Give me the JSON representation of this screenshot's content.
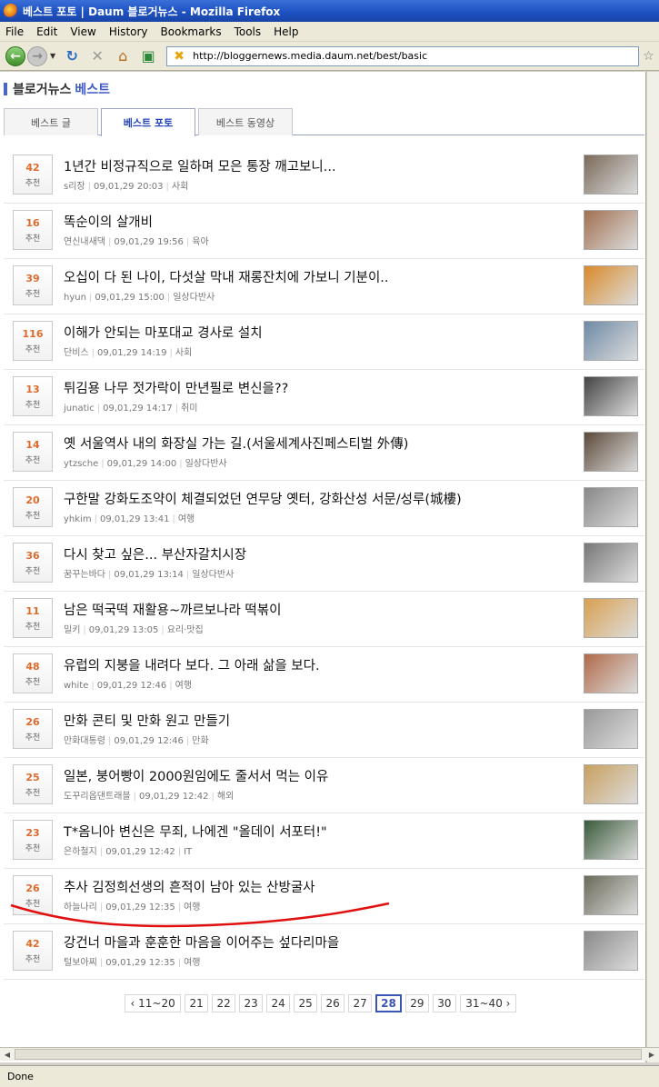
{
  "window": {
    "title": "베스트 포토 | Daum 블로거뉴스 - Mozilla Firefox"
  },
  "menu": [
    "File",
    "Edit",
    "View",
    "History",
    "Bookmarks",
    "Tools",
    "Help"
  ],
  "address": {
    "url": "http://bloggernews.media.daum.net/best/basic"
  },
  "header": {
    "brand": "블로거뉴스",
    "section": "베스트"
  },
  "tabs": [
    "베스트 글",
    "베스트 포토",
    "베스트 동영상"
  ],
  "active_tab": 1,
  "vote_label": "추천",
  "items": [
    {
      "votes": "42",
      "title": "1년간 비정규직으로 일하며 모은 통장 깨고보니...",
      "author": "s리장",
      "time": "09,01,29 20:03",
      "category": "사회",
      "thumb_color": "#7a6a5a"
    },
    {
      "votes": "16",
      "title": "똑순이의 살개비",
      "author": "연신내새댁",
      "time": "09,01,29 19:56",
      "category": "육아",
      "thumb_color": "#a07050"
    },
    {
      "votes": "39",
      "title": "오십이 다 된 나이, 다섯살 막내 재롱잔치에 가보니 기분이..",
      "author": "hyun",
      "time": "09,01,29 15:00",
      "category": "일상다반사",
      "thumb_color": "#d98a2a"
    },
    {
      "votes": "116",
      "title": "이해가 안되는 마포대교 경사로 설치",
      "author": "단비스",
      "time": "09,01,29 14:19",
      "category": "사회",
      "thumb_color": "#6f8aa6"
    },
    {
      "votes": "13",
      "title": "튀김용 나무 젓가락이 만년필로 변신을??",
      "author": "junatic",
      "time": "09,01,29 14:17",
      "category": "취미",
      "thumb_color": "#444444"
    },
    {
      "votes": "14",
      "title": "옛 서울역사 내의 화장실 가는 길.(서울세계사진페스티벌 外傳)",
      "author": "ytzsche",
      "time": "09,01,29 14:00",
      "category": "일상다반사",
      "thumb_color": "#5c4a3a"
    },
    {
      "votes": "20",
      "title": "구한말 강화도조약이 체결되었던 연무당 옛터, 강화산성 서문/성루(城樓)",
      "author": "yhkim",
      "time": "09,01,29 13:41",
      "category": "여행",
      "thumb_color": "#888888"
    },
    {
      "votes": "36",
      "title": "다시 찾고 싶은... 부산자갈치시장",
      "author": "꿈꾸는바다",
      "time": "09,01,29 13:14",
      "category": "일상다반사",
      "thumb_color": "#777777"
    },
    {
      "votes": "11",
      "title": "남은 떡국떡 재활용~까르보나라 떡볶이",
      "author": "밀키",
      "time": "09,01,29 13:05",
      "category": "요리·맛집",
      "thumb_color": "#d8a050"
    },
    {
      "votes": "48",
      "title": "유럽의 지붕을 내려다 보다. 그 아래 삶을 보다.",
      "author": "white",
      "time": "09,01,29 12:46",
      "category": "여행",
      "thumb_color": "#b06a4a"
    },
    {
      "votes": "26",
      "title": "만화 콘티 및 만화 원고 만들기",
      "author": "만화대통령",
      "time": "09,01,29 12:46",
      "category": "만화",
      "thumb_color": "#999999"
    },
    {
      "votes": "25",
      "title": "일본, 붕어빵이 2000원임에도 줄서서 먹는 이유",
      "author": "도꾸리옵댄트래블",
      "time": "09,01,29 12:42",
      "category": "해외",
      "thumb_color": "#c8a060"
    },
    {
      "votes": "23",
      "title": "T*옴니아 변신은 무죄, 나에겐 \"올데이 서포터!\"",
      "author": "은하철지",
      "time": "09,01,29 12:42",
      "category": "IT",
      "thumb_color": "#3a5a3a"
    },
    {
      "votes": "26",
      "title": "추사 김정희선생의 흔적이 남아 있는 산방굴사",
      "author": "하늘나리",
      "time": "09,01,29 12:35",
      "category": "여행",
      "thumb_color": "#6a6a5a"
    },
    {
      "votes": "42",
      "title": "강건너 마을과 훈훈한 마음을 이어주는 섶다리마을",
      "author": "털보아찌",
      "time": "09,01,29 12:35",
      "category": "여행",
      "thumb_color": "#8a8a8a"
    }
  ],
  "pagination": {
    "prev": "11~20",
    "pages": [
      "21",
      "22",
      "23",
      "24",
      "25",
      "26",
      "27",
      "28",
      "29",
      "30"
    ],
    "current": "28",
    "next": "31~40"
  },
  "status": "Done"
}
